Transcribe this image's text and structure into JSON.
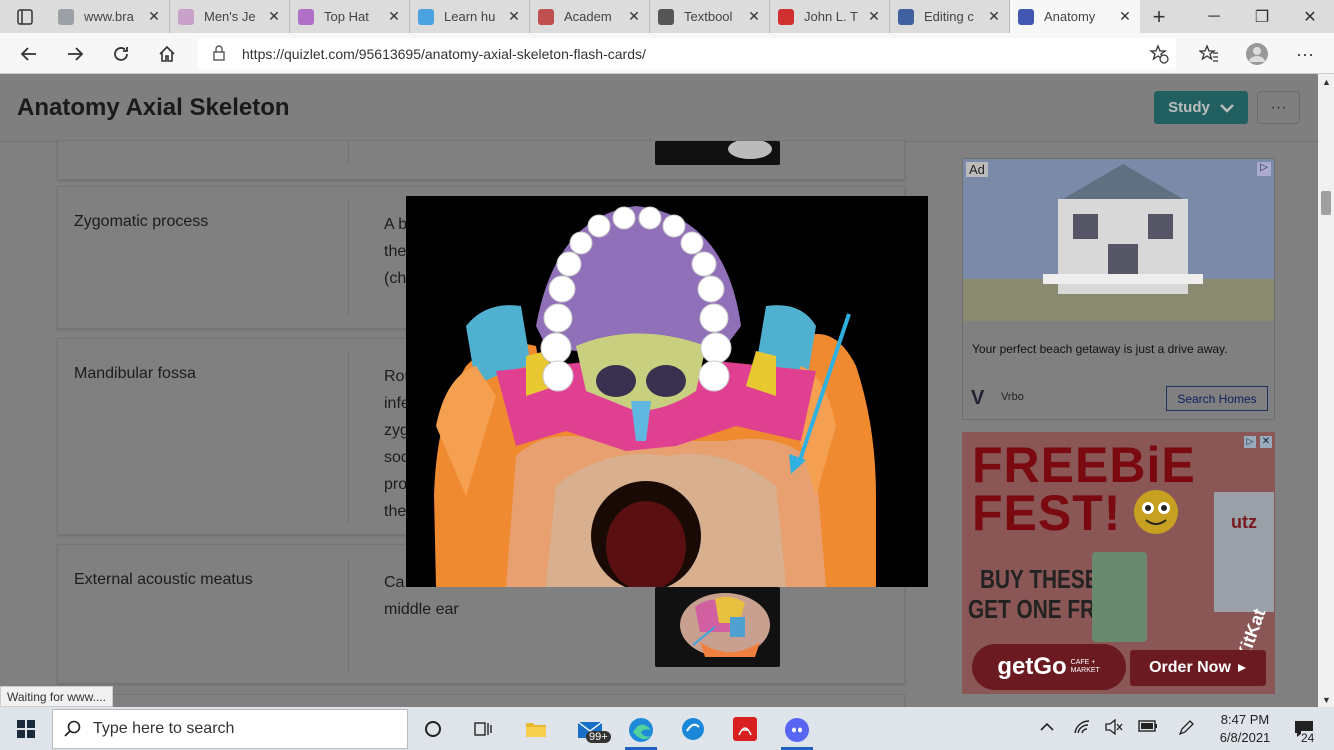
{
  "browser": {
    "tabs": [
      {
        "title": "www.bra",
        "color": "#9aa0a6"
      },
      {
        "title": "Men's Je",
        "color": "#c8a0c8"
      },
      {
        "title": "Top Hat",
        "color": "#b070c8"
      },
      {
        "title": "Learn hu",
        "color": "#4aa3df"
      },
      {
        "title": "Academ",
        "color": "#c05050"
      },
      {
        "title": "Textbool",
        "color": "#555555"
      },
      {
        "title": "John L. T",
        "color": "#d03030"
      },
      {
        "title": "Editing c",
        "color": "#4060a0"
      },
      {
        "title": "Anatomy",
        "color": "#4257b2"
      }
    ],
    "url": "https://quizlet.com/95613695/anatomy-axial-skeleton-flash-cards/"
  },
  "header": {
    "title": "Anatomy Axial Skeleton",
    "study_label": "Study",
    "more_label": "···"
  },
  "cards": [
    {
      "term": "Zygomatic process",
      "definition_lines": [
        "A b",
        "the",
        "(ch"
      ]
    },
    {
      "term": "Mandibular fossa",
      "definition_lines": [
        "Rou",
        "infe",
        "zyg",
        "soc",
        "pro",
        "the"
      ]
    },
    {
      "term": "External acoustic meatus",
      "definition_lines": [
        "Ca",
        "middle ear"
      ]
    }
  ],
  "ads": {
    "ad1": {
      "badge": "Ad",
      "text": "Your perfect beach getaway is just a drive away.",
      "brand": "Vrbo",
      "cta": "Search Homes"
    },
    "ad2": {
      "headline1": "FREEBiE",
      "headline2": "FEST!",
      "line1": "BUY THESE,",
      "line2": "GET ONE FREE!",
      "brand": "getGo",
      "brand_sub": "CAFE + MARKET",
      "cta": "Order Now",
      "product1": "utz",
      "product2": "KitKat"
    }
  },
  "status_text": "Waiting for www....",
  "taskbar": {
    "search_placeholder": "Type here to search",
    "mail_badge": "99+",
    "time": "8:47 PM",
    "date": "6/8/2021",
    "notif_count": "24"
  }
}
